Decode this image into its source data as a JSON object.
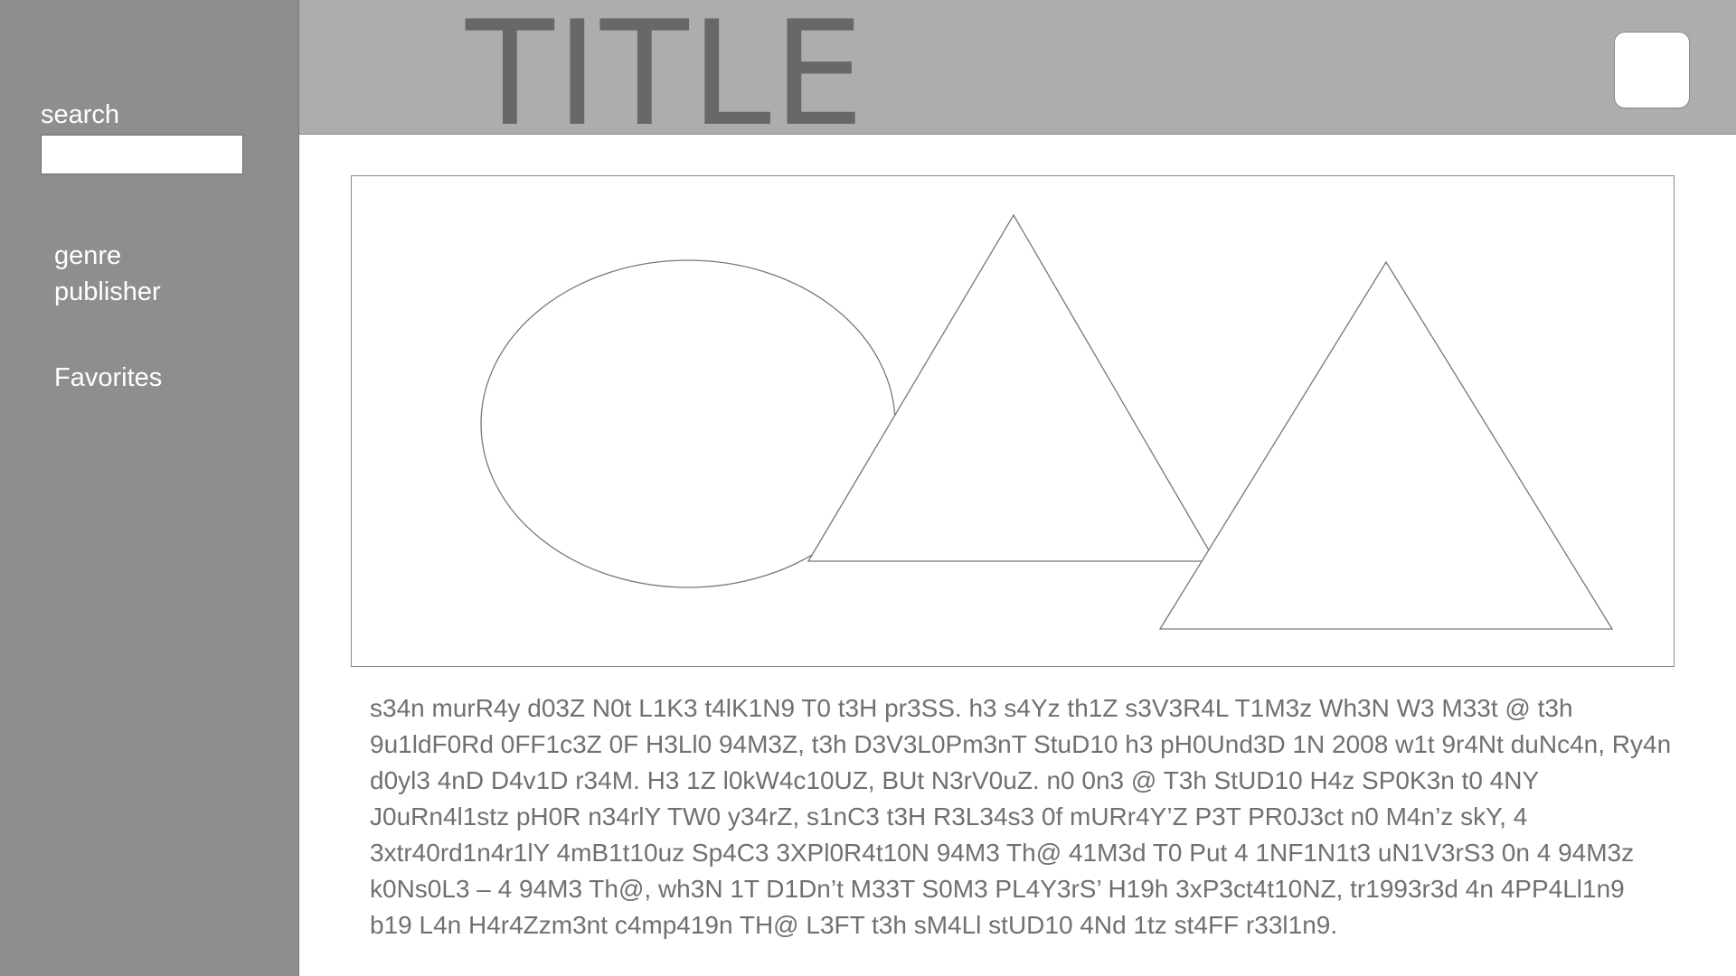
{
  "sidebar": {
    "search_label": "search",
    "search_value": "",
    "nav": {
      "genre": "genre",
      "publisher": "publisher",
      "favorites": "Favorites"
    }
  },
  "header": {
    "title": "TITLE"
  },
  "content": {
    "paragraph": "s34n murR4y d03Z N0t L1K3 t4lK1N9 T0 t3H pr3SS. h3 s4Yz th1Z s3V3R4L T1M3z Wh3N W3 M33t @ t3h 9u1ldF0Rd 0FF1c3Z 0F H3Ll0 94M3Z, t3h D3V3L0Pm3nT StuD10 h3 pH0Und3D 1N 2008 w1t 9r4Nt duNc4n, Ry4n d0yl3 4nD D4v1D r34M. H3 1Z l0kW4c10UZ, BUt N3rV0uZ. n0 0n3 @ T3h StUD10 H4z SP0K3n t0 4NY J0uRn4l1stz pH0R n34rlY TW0 y34rZ, s1nC3 t3H R3L34s3 0f mURr4Y’Z P3T PR0J3ct n0 M4n’z skY, 4 3xtr40rd1n4r1lY 4mB1t10uz Sp4C3 3XPl0R4t10N 94M3 Th@ 41M3d T0 Put 4 1NF1N1t3 uN1V3rS3 0n 4 94M3z k0Ns0L3 – 4 94M3 Th@, wh3N 1T D1Dn’t M33T S0M3 PL4Y3rS’ H19h 3xP3ct4t10NZ, tr1993r3d 4n 4PP4Ll1n9 b19 L4n H4r4Zzm3nt c4mp419n TH@ L3FT t3h sM4Ll stUD10 4Nd 1tz st4FF r33l1n9."
  }
}
